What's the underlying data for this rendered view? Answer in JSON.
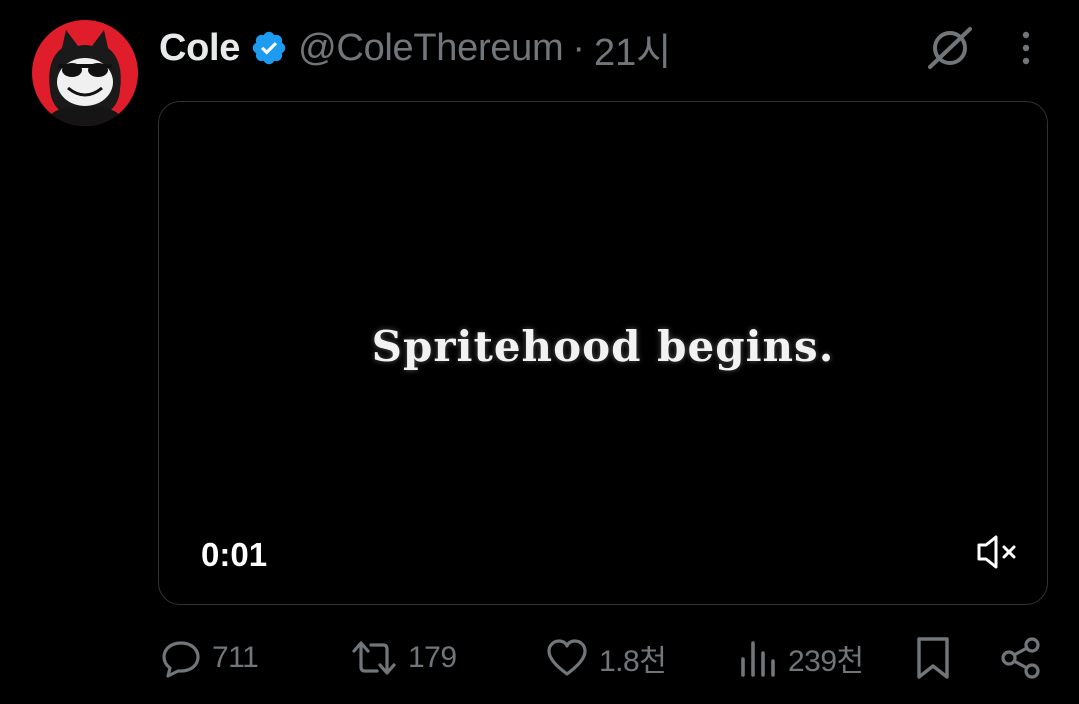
{
  "tweet": {
    "author_name": "Cole",
    "handle": "@ColeThereum",
    "separator": "·",
    "time": "21시",
    "verified": true
  },
  "media": {
    "caption": "Spritehood begins.",
    "timestamp": "0:01",
    "muted": true
  },
  "actions": {
    "replies": "711",
    "reposts": "179",
    "likes": "1.8천",
    "views": "239천"
  },
  "icons": {
    "header": [
      "grok-icon",
      "more-options-icon"
    ],
    "media": [
      "volume-muted-icon"
    ],
    "actions": [
      "reply-icon",
      "repost-icon",
      "like-icon",
      "views-icon",
      "bookmark-icon",
      "share-icon"
    ]
  },
  "colors": {
    "background": "#000000",
    "primary_text": "#e7e9ea",
    "secondary_text": "#71767b",
    "verified_blue": "#1d9bf0",
    "avatar_red": "#e01e2b",
    "media_border": "#2f3336"
  }
}
